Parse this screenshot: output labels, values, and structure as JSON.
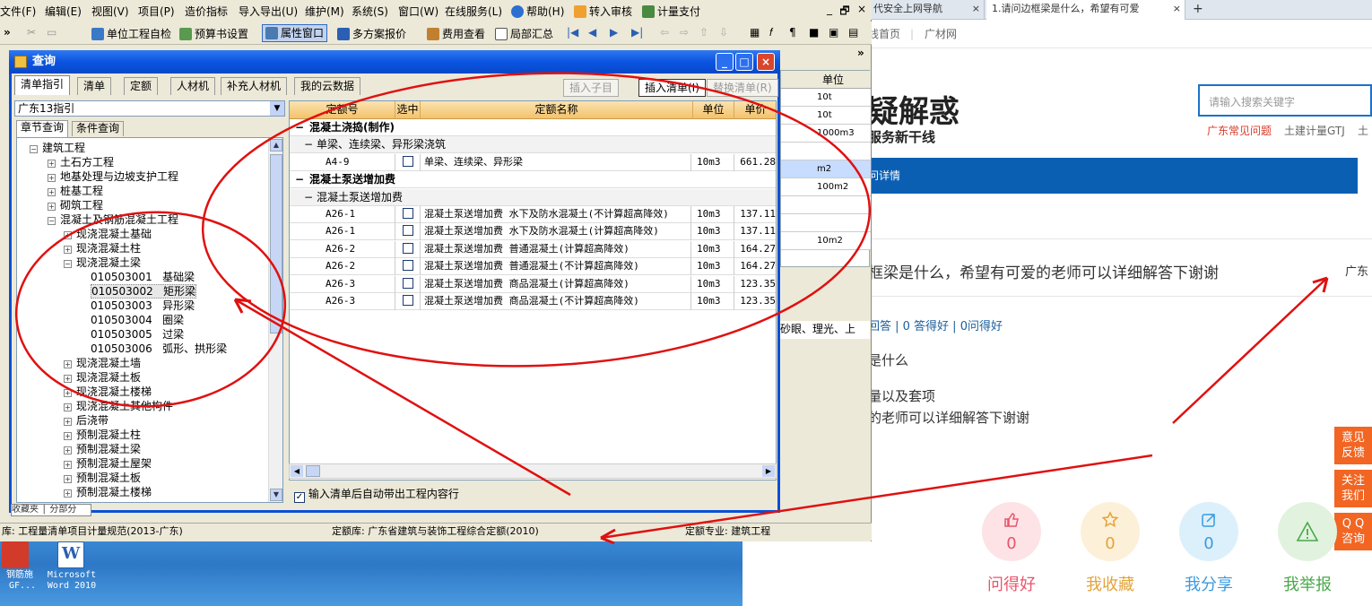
{
  "menubar": {
    "items": [
      "文件(F)",
      "编辑(E)",
      "视图(V)",
      "项目(P)",
      "造价指标",
      "导入导出(U)",
      "维护(M)",
      "系统(S)",
      "窗口(W)",
      "在线服务(L)",
      "帮助(H)",
      "转入审核",
      "计量支付"
    ],
    "win_controls": [
      "_",
      "🗗",
      "×"
    ]
  },
  "toolbar": {
    "items": [
      "单位工程自检",
      "预算书设置",
      "属性窗口",
      "多方案报价",
      "费用查看",
      "局部汇总"
    ]
  },
  "dialog": {
    "title": "查询",
    "tabs": [
      "清单指引",
      "清单",
      "定额",
      "人材机",
      "补充人材机",
      "我的云数据"
    ],
    "buttons": [
      "插入子目",
      "插入清单(I)",
      "替换清单(R)"
    ],
    "combo_value": "广东13指引",
    "subtabs": [
      "章节查询",
      "条件查询"
    ],
    "tree": [
      {
        "level": 0,
        "sign": "−",
        "label": "建筑工程"
      },
      {
        "level": 1,
        "sign": "+",
        "label": "土石方工程"
      },
      {
        "level": 1,
        "sign": "+",
        "label": "地基处理与边坡支护工程"
      },
      {
        "level": 1,
        "sign": "+",
        "label": "桩基工程"
      },
      {
        "level": 1,
        "sign": "+",
        "label": "砌筑工程"
      },
      {
        "level": 1,
        "sign": "−",
        "label": "混凝土及钢筋混凝土工程"
      },
      {
        "level": 2,
        "sign": "+",
        "label": "现浇混凝土基础"
      },
      {
        "level": 2,
        "sign": "+",
        "label": "现浇混凝土柱"
      },
      {
        "level": 2,
        "sign": "−",
        "label": "现浇混凝土梁"
      },
      {
        "level": 3,
        "sign": "",
        "label": "010503001   基础梁"
      },
      {
        "level": 3,
        "sign": "",
        "label": "010503002   矩形梁",
        "selected": true
      },
      {
        "level": 3,
        "sign": "",
        "label": "010503003   异形梁"
      },
      {
        "level": 3,
        "sign": "",
        "label": "010503004   圈梁"
      },
      {
        "level": 3,
        "sign": "",
        "label": "010503005   过梁"
      },
      {
        "level": 3,
        "sign": "",
        "label": "010503006   弧形、拱形梁"
      },
      {
        "level": 2,
        "sign": "+",
        "label": "现浇混凝土墙"
      },
      {
        "level": 2,
        "sign": "+",
        "label": "现浇混凝土板"
      },
      {
        "level": 2,
        "sign": "+",
        "label": "现浇混凝土楼梯"
      },
      {
        "level": 2,
        "sign": "+",
        "label": "现浇混凝土其他构件"
      },
      {
        "level": 2,
        "sign": "+",
        "label": "后浇带"
      },
      {
        "level": 2,
        "sign": "+",
        "label": "预制混凝土柱"
      },
      {
        "level": 2,
        "sign": "+",
        "label": "预制混凝土梁"
      },
      {
        "level": 2,
        "sign": "+",
        "label": "预制混凝土屋架"
      },
      {
        "level": 2,
        "sign": "+",
        "label": "预制混凝土板"
      },
      {
        "level": 2,
        "sign": "+",
        "label": "预制混凝土楼梯"
      }
    ],
    "grid": {
      "headers": [
        "定额号",
        "选中",
        "定额名称",
        "单位",
        "单价"
      ],
      "rows": [
        {
          "type": "section",
          "text": "混凝土浇捣(制作)"
        },
        {
          "type": "sub",
          "text": "单梁、连续梁、异形梁浇筑"
        },
        {
          "type": "item",
          "code": "A4-9",
          "name": "单梁、连续梁、异形梁",
          "unit": "10m3",
          "price": "661.28"
        },
        {
          "type": "section",
          "text": "混凝土泵送增加费"
        },
        {
          "type": "sub",
          "text": "混凝土泵送增加费"
        },
        {
          "type": "item",
          "code": "A26-1",
          "name": "混凝土泵送增加费 水下及防水混凝土(不计算超高降效)",
          "unit": "10m3",
          "price": "137.11"
        },
        {
          "type": "item",
          "code": "A26-1",
          "name": "混凝土泵送增加费 水下及防水混凝土(计算超高降效)",
          "unit": "10m3",
          "price": "137.11"
        },
        {
          "type": "item",
          "code": "A26-2",
          "name": "混凝土泵送增加费 普通混凝土(计算超高降效)",
          "unit": "10m3",
          "price": "164.27"
        },
        {
          "type": "item",
          "code": "A26-2",
          "name": "混凝土泵送增加费 普通混凝土(不计算超高降效)",
          "unit": "10m3",
          "price": "164.27"
        },
        {
          "type": "item",
          "code": "A26-3",
          "name": "混凝土泵送增加费 商品混凝土(计算超高降效)",
          "unit": "10m3",
          "price": "123.35"
        },
        {
          "type": "item",
          "code": "A26-3",
          "name": "混凝土泵送增加费 商品混凝土(不计算超高降效)",
          "unit": "10m3",
          "price": "123.35"
        }
      ]
    },
    "bottom_check_label": "输入清单后自动带出工程内容行"
  },
  "behind": {
    "unit_header": "单位",
    "units": [
      "10t",
      "10t",
      "1000m3",
      "",
      "m2",
      "100m2",
      "",
      "",
      "10m2"
    ],
    "text_snippet": "砂眼、理光、上"
  },
  "statusbar": {
    "left": "库: 工程量清单项目计量规范(2013-广东)",
    "mid": "定额库: 广东省建筑与装饰工程综合定额(2010)",
    "right": "定额专业: 建筑工程"
  },
  "desktop": {
    "icon1": "钢筋施\n GF...",
    "icon2": "Microsoft\nWord 2010"
  },
  "browser": {
    "tab1": "代安全上网导航",
    "tab2": "1.请问边框梁是什么，希望有可爱",
    "bookmarks": [
      "线首页",
      "广材网"
    ],
    "title": "疑解惑",
    "subtitle": "服务新干线",
    "search_placeholder": "请输入搜索关键字",
    "hot_links": [
      "广东常见问题",
      "土建计量GTJ",
      "土"
    ],
    "blue_bar": "问详情",
    "question": "框梁是什么，希望有可爱的老师可以详细解答下谢谢",
    "region": "广东",
    "stats": "回答 | 0 答得好 | 0问得好",
    "body_lines": [
      "是什么",
      "量以及套项",
      "的老师可以详细解答下谢谢"
    ],
    "side_buttons": [
      "意见\n反馈",
      "关注\n我们",
      "Q Q\n咨询"
    ],
    "actions": [
      {
        "label": "问得好",
        "count": "0",
        "color": "#e8556a",
        "bg": "#fde3e6"
      },
      {
        "label": "我收藏",
        "count": "0",
        "color": "#e3a43a",
        "bg": "#fdf0d9"
      },
      {
        "label": "我分享",
        "count": "0",
        "color": "#3a9ae0",
        "bg": "#dcf0fb"
      },
      {
        "label": "我举报",
        "count": "",
        "color": "#4aa84a",
        "bg": "#e1f3de"
      }
    ]
  },
  "colors": {
    "accent": "#0b5fb3",
    "title_bar": "#0b54e0",
    "annotation": "#e01010",
    "selection": "#c7dcff"
  }
}
